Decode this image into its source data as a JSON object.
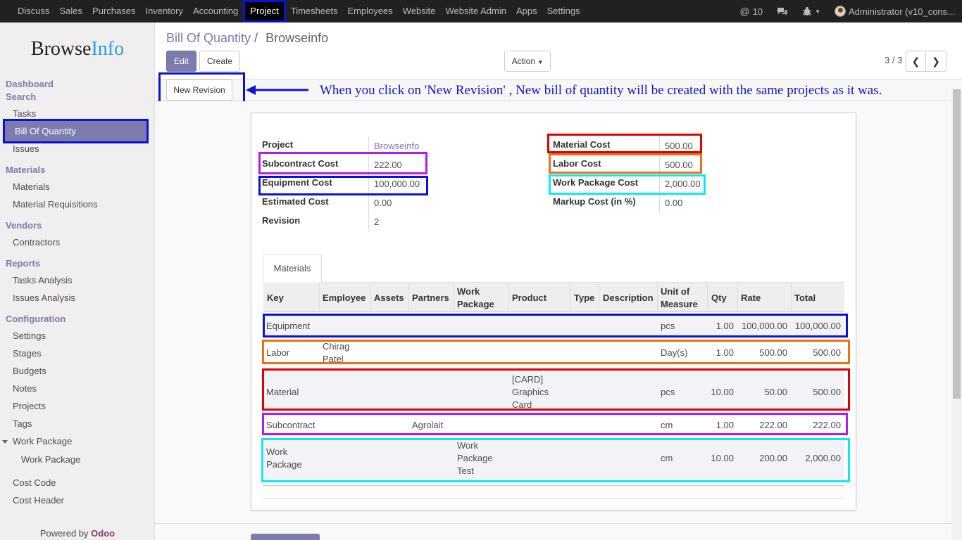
{
  "topbar": {
    "menu": [
      "Discuss",
      "Sales",
      "Purchases",
      "Inventory",
      "Accounting",
      "Project",
      "Timesheets",
      "Employees",
      "Website",
      "Website Admin",
      "Apps",
      "Settings"
    ],
    "active_menu": "Project",
    "mentions_count": "10",
    "user_label": "Administrator (v10_cons..."
  },
  "sidebar": {
    "logo_part1": "Browse",
    "logo_part2": "Info",
    "sections": {
      "dashboard": "Dashboard",
      "search": "Search",
      "materials": "Materials",
      "vendors": "Vendors",
      "reports": "Reports",
      "configuration": "Configuration"
    },
    "items": {
      "tasks": "Tasks",
      "bill_of_quantity": "Bill Of Quantity",
      "issues": "Issues",
      "materials": "Materials",
      "material_requisitions": "Material Requisitions",
      "contractors": "Contractors",
      "tasks_analysis": "Tasks Analysis",
      "issues_analysis": "Issues Analysis",
      "settings": "Settings",
      "stages": "Stages",
      "budgets": "Budgets",
      "notes": "Notes",
      "projects": "Projects",
      "tags": "Tags",
      "work_package_group": "Work Package",
      "work_package": "Work Package",
      "cost_code": "Cost Code",
      "cost_header": "Cost Header"
    },
    "powered_by": "Powered by",
    "powered_brand": "Odoo"
  },
  "control_panel": {
    "breadcrumb_parent": "Bill Of Quantity",
    "breadcrumb_sep": "/",
    "breadcrumb_current": "Browseinfo",
    "edit_label": "Edit",
    "create_label": "Create",
    "action_label": "Action",
    "pager": "3 / 3"
  },
  "statusbar": {
    "new_revision_label": "New Revision",
    "annotation": "When you click on 'New Revision' , New bill of quantity will be created with the same projects as it was."
  },
  "form": {
    "left": {
      "project_label": "Project",
      "project_value": "Browseinfo",
      "subcontract_label": "Subcontract Cost",
      "subcontract_value": "222.00",
      "equipment_label": "Equipment Cost",
      "equipment_value": "100,000.00",
      "estimated_label": "Estimated Cost",
      "estimated_value": "0.00",
      "revision_label": "Revision",
      "revision_value": "2"
    },
    "right": {
      "material_label": "Material Cost",
      "material_value": "500.00",
      "labor_label": "Labor Cost",
      "labor_value": "500.00",
      "workpkg_label": "Work Package Cost",
      "workpkg_value": "2,000.00",
      "markup_label": "Markup Cost (in %)",
      "markup_value": "0.00"
    },
    "tab_label": "Materials"
  },
  "table": {
    "headers": {
      "key": "Key",
      "employee": "Employee",
      "assets": "Assets",
      "partners": "Partners",
      "work_package_1": "Work",
      "work_package_2": "Package",
      "product": "Product",
      "type": "Type",
      "description": "Description",
      "uom_1": "Unit of",
      "uom_2": "Measure",
      "qty": "Qty",
      "rate": "Rate",
      "total": "Total"
    },
    "rows": [
      {
        "key": "Equipment",
        "employee": "",
        "partner": "",
        "work_package": "",
        "product": "",
        "uom": "pcs",
        "qty": "1.00",
        "rate": "100,000.00",
        "total": "100,000.00"
      },
      {
        "key": "Labor",
        "employee_1": "Chirag",
        "employee_2": "Patel",
        "uom": "Day(s)",
        "qty": "1.00",
        "rate": "500.00",
        "total": "500.00"
      },
      {
        "key": "Material",
        "product_1": "[CARD]",
        "product_2": "Graphics",
        "product_3": "Card",
        "uom": "pcs",
        "qty": "10.00",
        "rate": "50.00",
        "total": "500.00"
      },
      {
        "key": "Subcontract",
        "partner": "Agrolait",
        "uom": "cm",
        "qty": "1.00",
        "rate": "222.00",
        "total": "222.00"
      },
      {
        "key_1": "Work",
        "key_2": "Package",
        "wp_1": "Work",
        "wp_2": "Package",
        "wp_3": "Test",
        "uom": "cm",
        "qty": "10.00",
        "rate": "200.00",
        "total": "2,000.00"
      }
    ]
  },
  "colors": {
    "brand": "#7c7bad",
    "highlight_blue": "#0a12d8",
    "highlight_purple": "#b01cf0",
    "highlight_red": "#e00000",
    "highlight_orange": "#f07010",
    "highlight_cyan": "#10e8f0"
  }
}
